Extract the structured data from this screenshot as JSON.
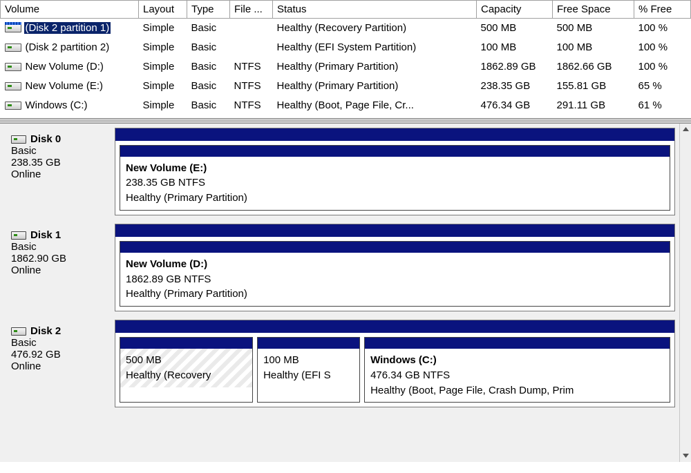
{
  "columns": {
    "volume": "Volume",
    "layout": "Layout",
    "type": "Type",
    "fs": "File ...",
    "status": "Status",
    "capacity": "Capacity",
    "free": "Free Space",
    "pct": "% Free"
  },
  "volumes": [
    {
      "name": "(Disk 2 partition 1)",
      "layout": "Simple",
      "type": "Basic",
      "fs": "",
      "status": "Healthy (Recovery Partition)",
      "capacity": "500 MB",
      "free": "500 MB",
      "pct": "100 %",
      "selected": true
    },
    {
      "name": "(Disk 2 partition 2)",
      "layout": "Simple",
      "type": "Basic",
      "fs": "",
      "status": "Healthy (EFI System Partition)",
      "capacity": "100 MB",
      "free": "100 MB",
      "pct": "100 %",
      "selected": false
    },
    {
      "name": "New Volume (D:)",
      "layout": "Simple",
      "type": "Basic",
      "fs": "NTFS",
      "status": "Healthy (Primary Partition)",
      "capacity": "1862.89 GB",
      "free": "1862.66 GB",
      "pct": "100 %",
      "selected": false
    },
    {
      "name": "New Volume (E:)",
      "layout": "Simple",
      "type": "Basic",
      "fs": "NTFS",
      "status": "Healthy (Primary Partition)",
      "capacity": "238.35 GB",
      "free": "155.81 GB",
      "pct": "65 %",
      "selected": false
    },
    {
      "name": "Windows (C:)",
      "layout": "Simple",
      "type": "Basic",
      "fs": "NTFS",
      "status": "Healthy (Boot, Page File, Cr...",
      "capacity": "476.34 GB",
      "free": "291.11 GB",
      "pct": "61 %",
      "selected": false
    }
  ],
  "disks": [
    {
      "title": "Disk 0",
      "type": "Basic",
      "size": "238.35 GB",
      "state": "Online",
      "partitions": [
        {
          "title": "New Volume  (E:)",
          "line2": "238.35 GB NTFS",
          "line3": "Healthy (Primary Partition)",
          "flex": 1,
          "hatched": false
        }
      ]
    },
    {
      "title": "Disk 1",
      "type": "Basic",
      "size": "1862.90 GB",
      "state": "Online",
      "partitions": [
        {
          "title": "New Volume  (D:)",
          "line2": "1862.89 GB NTFS",
          "line3": "Healthy (Primary Partition)",
          "flex": 1,
          "hatched": false
        }
      ]
    },
    {
      "title": "Disk 2",
      "type": "Basic",
      "size": "476.92 GB",
      "state": "Online",
      "partitions": [
        {
          "title": "",
          "line2": "500 MB",
          "line3": "Healthy (Recovery",
          "flex": 0.26,
          "hatched": true
        },
        {
          "title": "",
          "line2": "100 MB",
          "line3": "Healthy (EFI S",
          "flex": 0.2,
          "hatched": false
        },
        {
          "title": "Windows  (C:)",
          "line2": "476.34 GB NTFS",
          "line3": "Healthy (Boot, Page File, Crash Dump, Prim",
          "flex": 0.6,
          "hatched": false
        }
      ]
    }
  ]
}
